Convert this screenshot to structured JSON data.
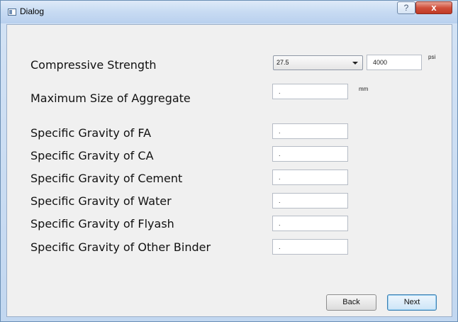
{
  "window": {
    "title": "Dialog",
    "help_label": "?",
    "close_label": "x"
  },
  "compressive": {
    "label": "Compressive Strength",
    "grade": "27.5",
    "value": "4000",
    "unit": "psi"
  },
  "aggregate": {
    "label": "Maximum Size of Aggregate",
    "value": ".",
    "unit": "mm"
  },
  "gravity": [
    {
      "label": "Specific Gravity of FA",
      "value": "."
    },
    {
      "label": "Specific Gravity of CA",
      "value": "."
    },
    {
      "label": "Specific Gravity of Cement",
      "value": "."
    },
    {
      "label": "Specific Gravity of Water",
      "value": "."
    },
    {
      "label": "Specific Gravity of Flyash",
      "value": "."
    },
    {
      "label": "Specific Gravity of Other Binder",
      "value": "."
    }
  ],
  "buttons": {
    "back": "Back",
    "next": "Next"
  }
}
